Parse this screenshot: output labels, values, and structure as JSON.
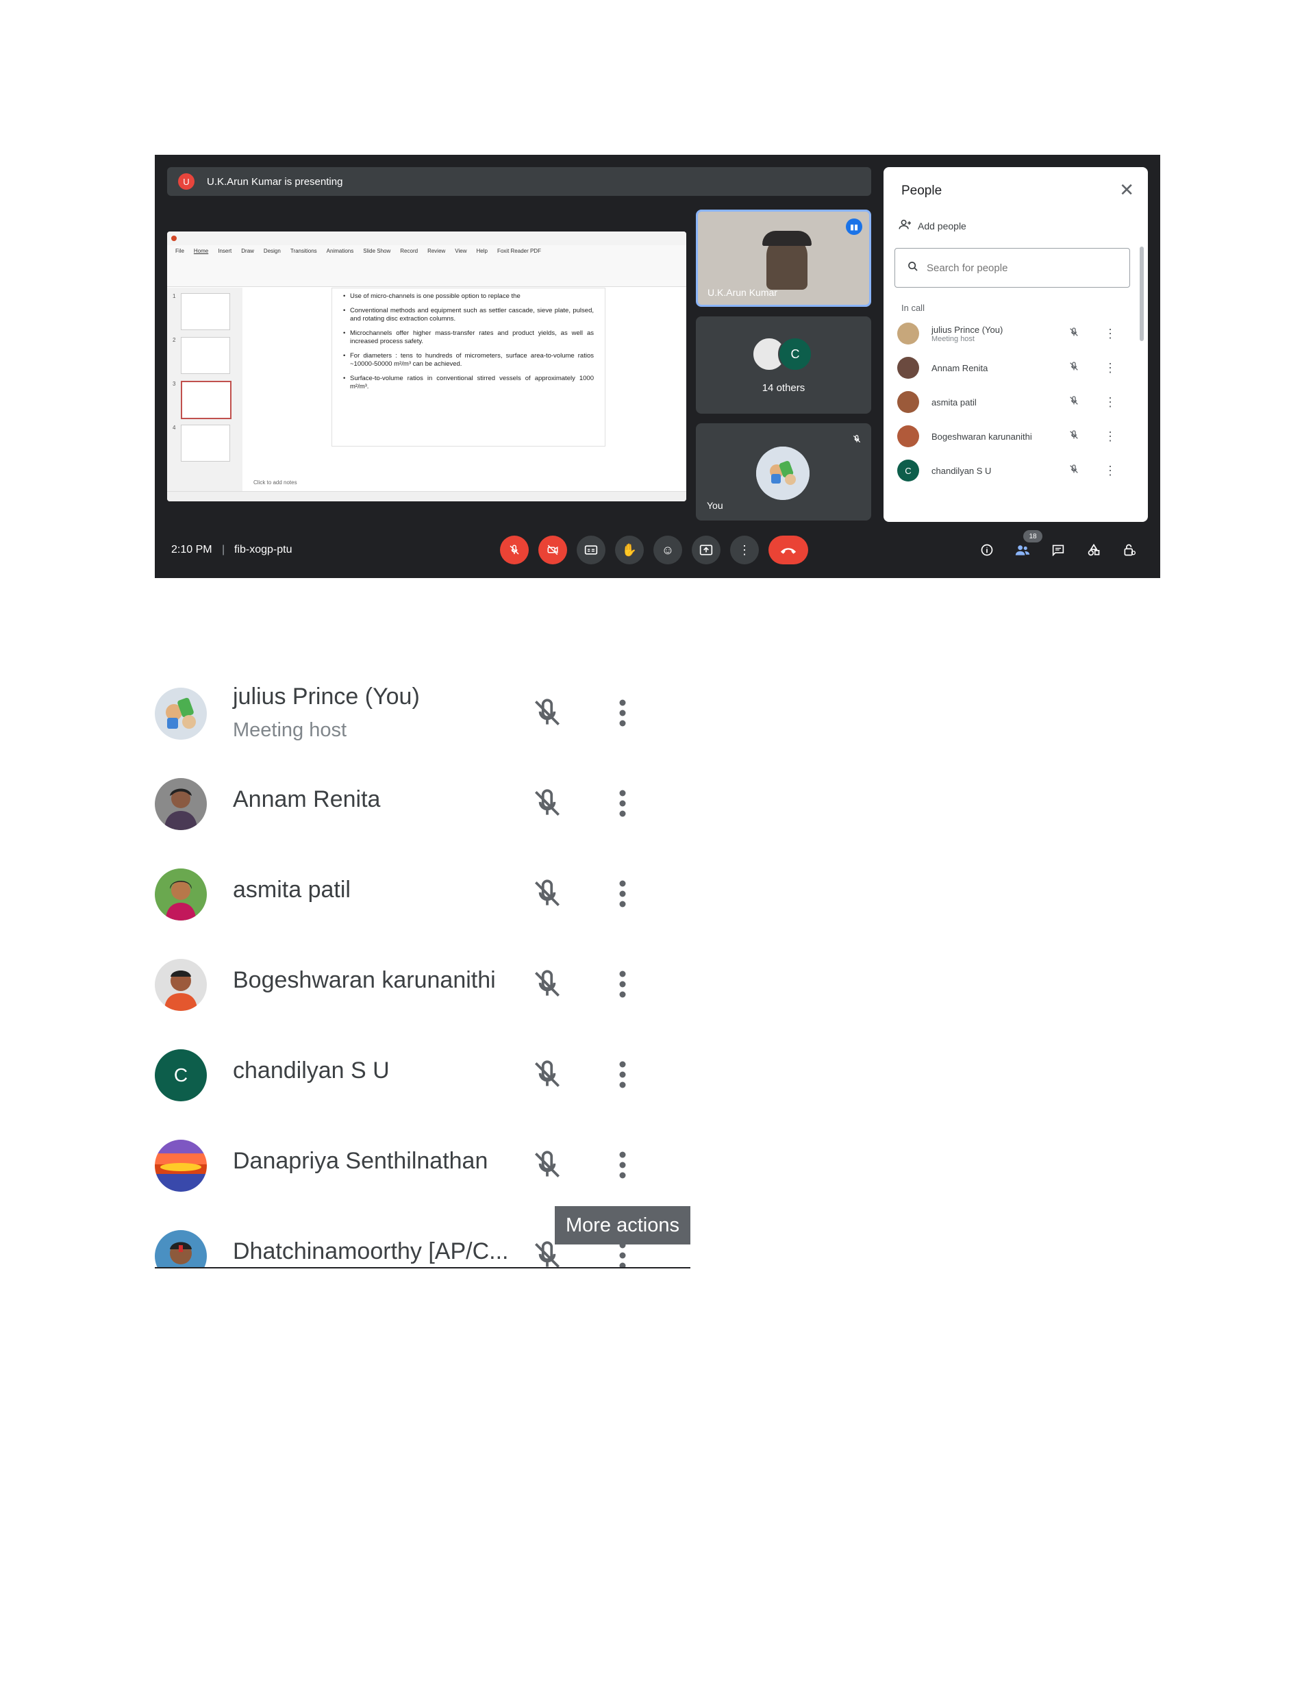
{
  "meet": {
    "presenting_banner": "U.K.Arun Kumar is presenting",
    "presenter_initial": "U",
    "presenter_tile_name": "U.K.Arun Kumar",
    "others_label": "14 others",
    "others_initial": "C",
    "you_label": "You",
    "clock": "2:10 PM",
    "separator": "|",
    "meeting_code": "fib-xogp-ptu",
    "participant_count": "18"
  },
  "slide": {
    "menu": [
      "File",
      "Home",
      "Insert",
      "Draw",
      "Design",
      "Transitions",
      "Animations",
      "Slide Show",
      "Record",
      "Review",
      "View",
      "Help",
      "Foxit Reader PDF"
    ],
    "bullets": [
      "Use of micro-channels is one possible option to replace the",
      "Conventional methods and equipment such as settler cascade, sieve plate, pulsed, and rotating disc extraction columns.",
      "Microchannels offer higher mass-transfer rates and product yields, as well as increased process safety.",
      "For diameters : tens to hundreds of micrometers, surface area-to-volume ratios ~10000-50000 m²/m³ can be achieved.",
      "Surface-to-volume ratios in conventional stirred vessels of approximately 1000 m²/m³."
    ],
    "notes_placeholder": "Click to add notes",
    "thumb_numbers": [
      "1",
      "2",
      "3",
      "4"
    ]
  },
  "people_panel": {
    "title": "People",
    "add_people": "Add people",
    "search_placeholder": "Search for people",
    "section": "In call",
    "participants": [
      {
        "name": "julius Prince (You)",
        "sub": "Meeting host",
        "color": "#c7a77b"
      },
      {
        "name": "Annam Renita",
        "sub": "",
        "color": "#6b4a3f"
      },
      {
        "name": "asmita patil",
        "sub": "",
        "color": "#9b5a3a"
      },
      {
        "name": "Bogeshwaran karunanithi",
        "sub": "",
        "color": "#b15a3a"
      },
      {
        "name": "chandilyan S U",
        "sub": "",
        "color": "#0d5e4b",
        "initial": "C"
      }
    ]
  },
  "zoomed_list": {
    "participants": [
      {
        "name": "julius Prince (You)",
        "sub": "Meeting host"
      },
      {
        "name": "Annam Renita",
        "sub": ""
      },
      {
        "name": "asmita patil",
        "sub": ""
      },
      {
        "name": "Bogeshwaran karunanithi",
        "sub": ""
      },
      {
        "name": "chandilyan S U",
        "sub": "",
        "initial": "C"
      },
      {
        "name": "Danapriya Senthilnathan",
        "sub": ""
      },
      {
        "name": "Dhatchinamoorthy [AP/C...",
        "sub": ""
      }
    ],
    "tooltip": "More actions"
  },
  "colors": {
    "meet_bg": "#202124",
    "tile_bg": "#3c4043",
    "danger": "#ea4335",
    "accent": "#1a73e8",
    "chandilyan_avatar": "#0d5e4b"
  },
  "icons": {
    "mic": "mic-off-icon",
    "camera": "camera-off-icon",
    "captions": "captions-icon",
    "hand": "raise-hand-icon",
    "emoji": "emoji-icon",
    "present": "present-icon",
    "more": "more-options-icon",
    "end": "end-call-icon",
    "info": "info-icon",
    "people": "people-icon",
    "chat": "chat-icon",
    "activities": "activities-icon",
    "host": "host-controls-icon"
  }
}
